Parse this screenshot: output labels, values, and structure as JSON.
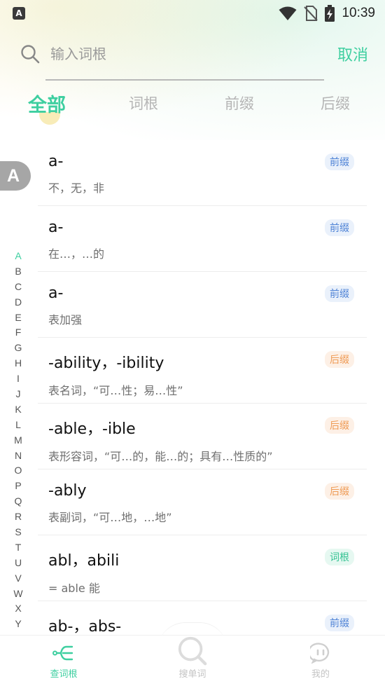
{
  "status_bar": {
    "time": "10:39",
    "notify_letter": "A"
  },
  "search": {
    "placeholder": "输入词根",
    "value": "",
    "cancel_label": "取消"
  },
  "tabs": [
    {
      "label": "全部",
      "active": true
    },
    {
      "label": "词根",
      "active": false
    },
    {
      "label": "前缀",
      "active": false
    },
    {
      "label": "后缀",
      "active": false
    }
  ],
  "current_letter": "A",
  "index_letters": [
    "A",
    "B",
    "C",
    "D",
    "E",
    "F",
    "G",
    "H",
    "I",
    "J",
    "K",
    "L",
    "M",
    "N",
    "O",
    "P",
    "Q",
    "R",
    "S",
    "T",
    "U",
    "V",
    "W",
    "X",
    "Y"
  ],
  "items": [
    {
      "title": "a-",
      "desc": "不，无，非",
      "tag": "前缀",
      "tag_type": "prefix"
    },
    {
      "title": "a-",
      "desc": "在…，…的",
      "tag": "前缀",
      "tag_type": "prefix"
    },
    {
      "title": "a-",
      "desc": "表加强",
      "tag": "前缀",
      "tag_type": "prefix"
    },
    {
      "title": "-ability，-ibility",
      "desc": "表名词，“可…性；易…性”",
      "tag": "后缀",
      "tag_type": "suffix"
    },
    {
      "title": "-able，-ible",
      "desc": "表形容词，“可…的，能…的；具有…性质的”",
      "tag": "后缀",
      "tag_type": "suffix"
    },
    {
      "title": "-ably",
      "desc": "表副词，“可…地，…地”",
      "tag": "后缀",
      "tag_type": "suffix"
    },
    {
      "title": "abl，abili",
      "desc": "= able 能",
      "tag": "词根",
      "tag_type": "root"
    },
    {
      "title": "ab-，abs-",
      "desc": "",
      "tag": "前缀",
      "tag_type": "prefix"
    }
  ],
  "bottom_nav": [
    {
      "label": "查词根",
      "icon": "tree-icon",
      "active": true
    },
    {
      "label": "搜单词",
      "icon": "search-icon",
      "active": false
    },
    {
      "label": "我的",
      "icon": "face-icon",
      "active": false
    }
  ],
  "colors": {
    "accent": "#3ecfa0",
    "prefix": "#4f83d6",
    "suffix": "#ef9b55",
    "root": "#34c292"
  }
}
